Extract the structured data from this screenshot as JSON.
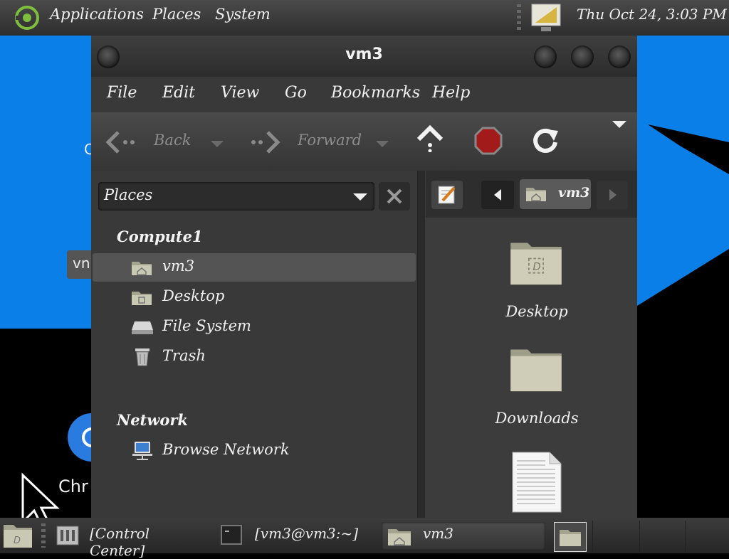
{
  "topbar": {
    "menus": [
      "Applications",
      "Places",
      "System"
    ],
    "clock": "Thu Oct 24,  3:03 PM"
  },
  "desktop": {
    "partial_label_1": "C",
    "partial_label_2": "vn",
    "partial_label_3": "Chr"
  },
  "window": {
    "title": "vm3",
    "menus": [
      "File",
      "Edit",
      "View",
      "Go",
      "Bookmarks",
      "Help"
    ],
    "toolbar": {
      "back": "Back",
      "forward": "Forward"
    },
    "side_pane": {
      "selector": "Places",
      "section_computer": "Compute1",
      "items": [
        "vm3",
        "Desktop",
        "File System",
        "Trash"
      ],
      "section_network": "Network",
      "network_items": [
        "Browse Network"
      ]
    },
    "path_button": "vm3",
    "files": [
      "Desktop",
      "Downloads"
    ]
  },
  "taskbar": {
    "tasks": [
      "[Control Center]",
      "[vm3@vm3:~]",
      "vm3"
    ]
  }
}
